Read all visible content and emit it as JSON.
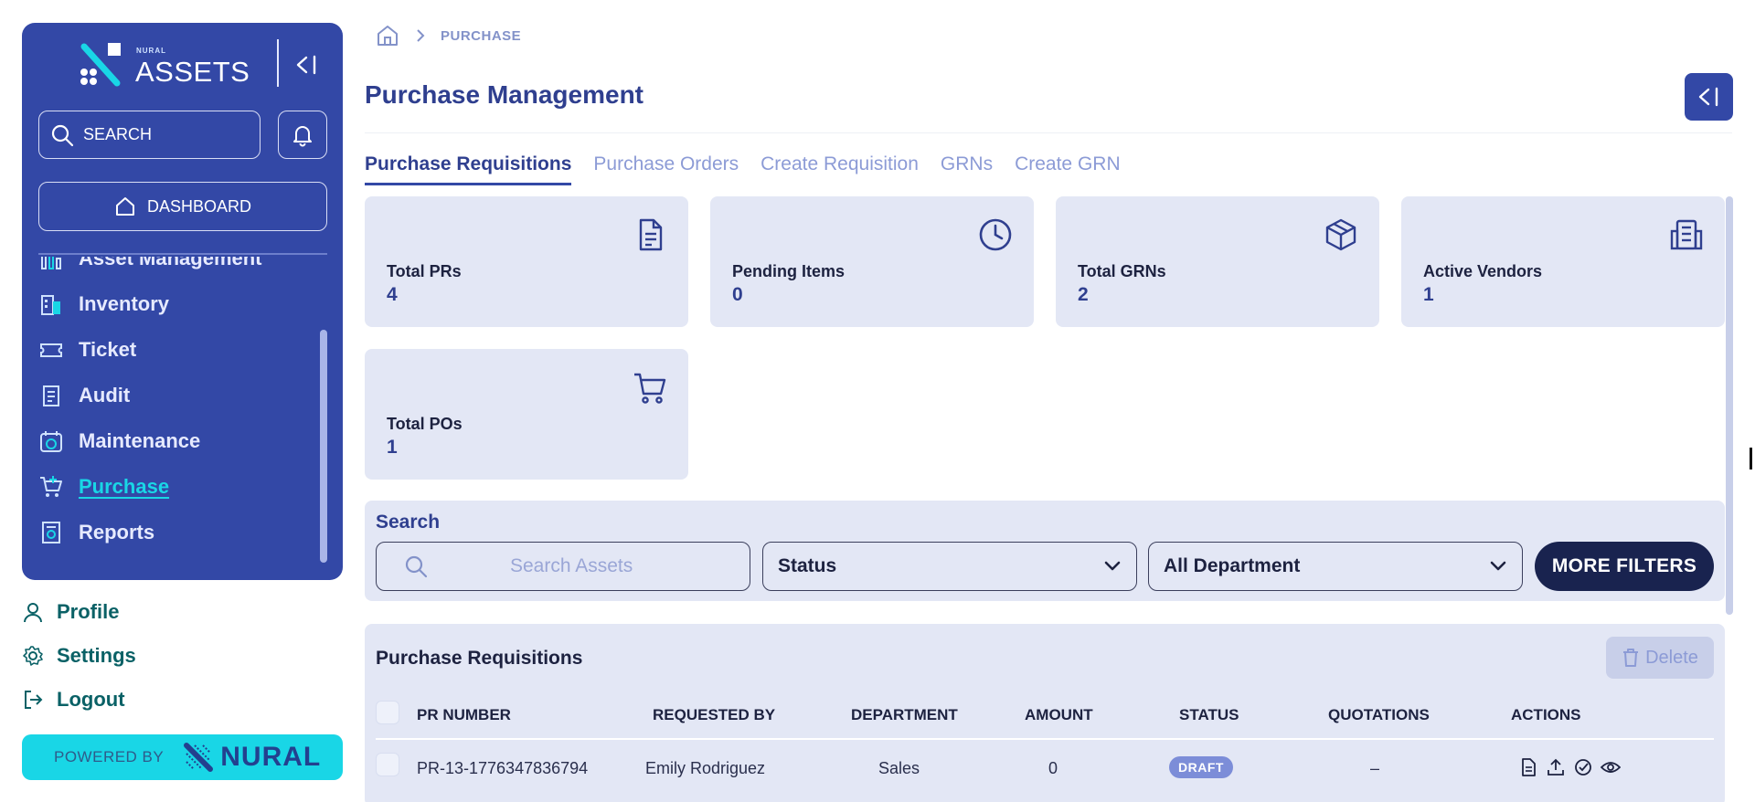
{
  "sidebar": {
    "logo_small": "NURAL",
    "logo_text": "ASSETS",
    "search_label": "SEARCH",
    "dashboard_label": "DASHBOARD",
    "items": [
      {
        "label": "Asset Management",
        "icon": "chart-icon"
      },
      {
        "label": "Inventory",
        "icon": "building-icon"
      },
      {
        "label": "Ticket",
        "icon": "ticket-icon"
      },
      {
        "label": "Audit",
        "icon": "clipboard-icon"
      },
      {
        "label": "Maintenance",
        "icon": "calendar-clock-icon"
      },
      {
        "label": "Purchase",
        "icon": "cart-plus-icon",
        "active": true
      },
      {
        "label": "Reports",
        "icon": "report-icon"
      }
    ],
    "lower": [
      {
        "label": "Profile",
        "icon": "user-icon"
      },
      {
        "label": "Settings",
        "icon": "gear-icon"
      },
      {
        "label": "Logout",
        "icon": "logout-icon"
      }
    ],
    "powered_by": "POWERED BY",
    "brand": "NURAL"
  },
  "breadcrumb": {
    "current": "PURCHASE"
  },
  "page": {
    "title": "Purchase Management"
  },
  "tabs": [
    {
      "label": "Purchase Requisitions",
      "active": true
    },
    {
      "label": "Purchase Orders"
    },
    {
      "label": "Create Requisition"
    },
    {
      "label": "GRNs"
    },
    {
      "label": "Create GRN"
    }
  ],
  "stats": [
    {
      "label": "Total PRs",
      "value": "4",
      "icon": "document-icon"
    },
    {
      "label": "Pending Items",
      "value": "0",
      "icon": "clock-icon"
    },
    {
      "label": "Total GRNs",
      "value": "2",
      "icon": "box-icon"
    },
    {
      "label": "Active Vendors",
      "value": "1",
      "icon": "building-icon"
    },
    {
      "label": "Total POs",
      "value": "1",
      "icon": "cart-icon"
    }
  ],
  "search": {
    "label": "Search",
    "placeholder": "Search Assets",
    "status": "Status",
    "department": "All Department",
    "more_filters": "MORE FILTERS"
  },
  "table": {
    "title": "Purchase Requisitions",
    "delete_label": "Delete",
    "columns": [
      "PR NUMBER",
      "REQUESTED BY",
      "DEPARTMENT",
      "AMOUNT",
      "STATUS",
      "QUOTATIONS",
      "ACTIONS"
    ],
    "rows": [
      {
        "pr_number": "PR-13-1776347836794",
        "requested_by": "Emily Rodriguez",
        "department": "Sales",
        "amount": "0",
        "status": "DRAFT",
        "quotations": "–"
      }
    ]
  },
  "colors": {
    "sidebar": "#3348a6",
    "accent": "#19d6e6",
    "card": "#e3e7f5",
    "title": "#2f3f8f",
    "dark_button": "#19234f"
  }
}
